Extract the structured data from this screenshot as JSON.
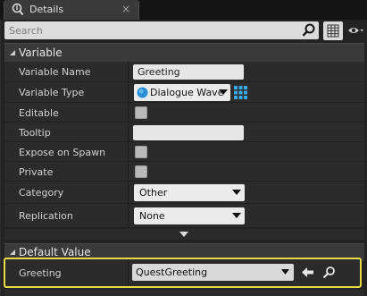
{
  "tab": {
    "title": "Details",
    "icon": "details-icon",
    "close": "×"
  },
  "search": {
    "placeholder": "Search",
    "value": ""
  },
  "sections": {
    "variable": {
      "title": "Variable"
    },
    "default_value": {
      "title": "Default Value"
    }
  },
  "properties": {
    "variable_name": {
      "label": "Variable Name",
      "value": "Greeting"
    },
    "variable_type": {
      "label": "Variable Type",
      "value": "Dialogue Wave",
      "icon": "dialogue-wave-type-icon"
    },
    "editable": {
      "label": "Editable",
      "checked": false
    },
    "tooltip": {
      "label": "Tooltip",
      "value": ""
    },
    "expose_on_spawn": {
      "label": "Expose on Spawn",
      "checked": false
    },
    "private": {
      "label": "Private",
      "checked": false
    },
    "category": {
      "label": "Category",
      "value": "Other"
    },
    "replication": {
      "label": "Replication",
      "value": "None"
    }
  },
  "default_value": {
    "label": "Greeting",
    "value": "QuestGreeting"
  },
  "colors": {
    "highlight_border": "#e8dc44",
    "type_grid": "#3aa9e6",
    "wave_icon": "#2a8fd4"
  }
}
